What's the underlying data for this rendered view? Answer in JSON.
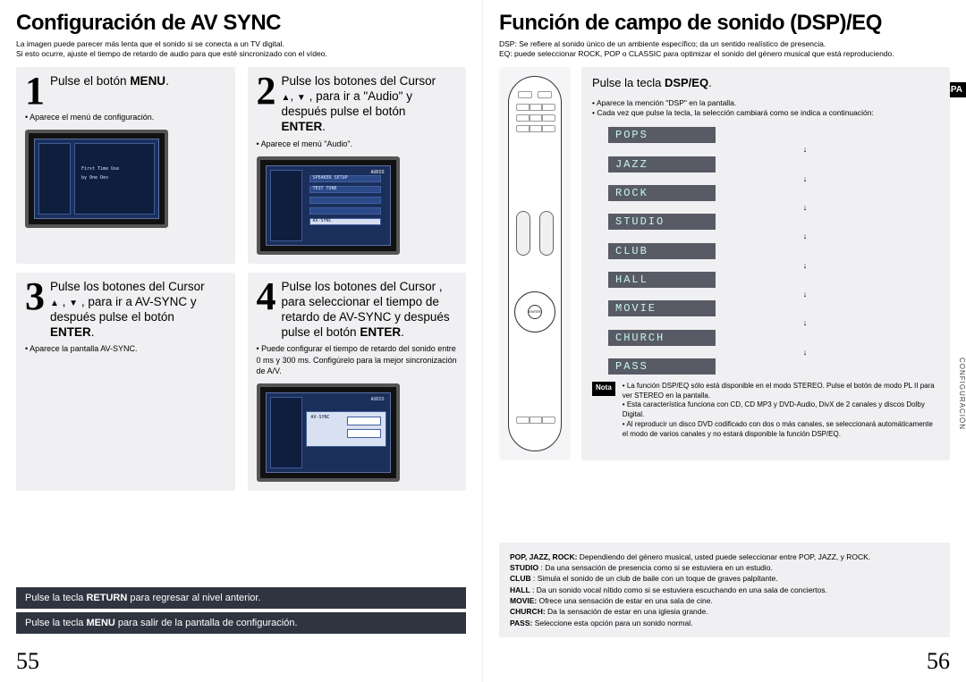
{
  "left": {
    "title": "Configuración de AV SYNC",
    "sub_line1": "La imagen puede parecer más lenta que el sonido si se conecta a un TV digital.",
    "sub_line2": "Si esto ocurre, ajuste el tiempo de retardo de audio para que esté sincronizado con el vídeo.",
    "step1": {
      "num": "1",
      "title_pre": "Pulse el botón ",
      "title_bold": "MENU",
      "title_post": ".",
      "body1": "Aparece el menú de configuración."
    },
    "step2": {
      "num": "2",
      "line1": "Pulse los botones del Cursor",
      "line2_pre": ", ",
      "line2_mid": " , para ir a \"Audio\" y",
      "line3": "después pulse el botón",
      "line4_bold": "ENTER",
      "line4_post": ".",
      "body1": "Aparece el menú \"Audio\"."
    },
    "step3": {
      "num": "3",
      "line1": "Pulse los botones del Cursor",
      "line2": ", , para ir a AV-SYNC y",
      "line3": "después pulse el botón",
      "line4_bold": "ENTER",
      "line4_post": ".",
      "body1": "Aparece la pantalla AV-SYNC."
    },
    "step4": {
      "num": "4",
      "line1": "Pulse los botones del Cursor   ,",
      "line2": "   para seleccionar el tiempo de",
      "line3": "retardo de AV-SYNC y después",
      "line4_pre": "pulse el botón ",
      "line4_bold": "ENTER",
      "line4_post": ".",
      "body1": "Puede configurar el tiempo de retardo del sonido entre 0 ms y 300 ms. Configúrelo para la mejor sincronización de A/V."
    },
    "footer1_pre": "Pulse la tecla ",
    "footer1_bold": "RETURN",
    "footer1_post": " para regresar al nivel anterior.",
    "footer2_pre": "Pulse la tecla ",
    "footer2_bold": "MENU",
    "footer2_post": " para salir de la pantalla de configuración.",
    "page_number": "55"
  },
  "right": {
    "title": "Función de campo de sonido (DSP)/EQ",
    "sub_line1": "DSP: Se refiere al sonido único de un ambiente específico; da un sentido realístico de presencia.",
    "sub_line2": "EQ: puede seleccionar ROCK, POP o CLASSIC para optimizar el sonido del género musical que está reproduciendo.",
    "spa_label": "SPA",
    "side_tab": "CONFIGURACIÓN",
    "step": {
      "title_pre": "Pulse la tecla ",
      "title_bold": "DSP/EQ",
      "title_post": ".",
      "bullet1": "Aparece  la mención \"DSP\" en la pantalla.",
      "bullet2": "Cada vez que pulse la tecla, la selección cambiará como se indica a continuación:"
    },
    "dsp_modes": [
      "POPS",
      "JAZZ",
      "ROCK",
      "STUDIO",
      "CLUB",
      "HALL",
      "MOVIE",
      "CHURCH",
      "PASS"
    ],
    "nota_label": "Nota",
    "nota": {
      "b1": "La función DSP/EQ sólo está disponible en el modo STEREO. Pulse el botón de modo       PL II para ver STEREO en la pantalla.",
      "b2": "Esta característica funciona con CD, CD MP3 y DVD-Audio, DivX de 2 canales y discos Dolby Digital.",
      "b3": "Al reproducir un disco DVD codificado con dos o más canales, se seleccionará automáticamente el modo de varios canales y no estará disponible la función DSP/EQ."
    },
    "modes": {
      "row1_b": "POP, JAZZ, ROCK:",
      "row1_t": " Dependiendo del género musical, usted puede seleccionar entre POP, JAZZ, y ROCK.",
      "row2_b": "STUDIO",
      "row2_t": " : Da una sensación de presencia como si se estuviera en un estudio.",
      "row3_b": "CLUB",
      "row3_t": " : Simula el sonido de un club de baile con un toque de graves palpitante.",
      "row4_b": "HALL",
      "row4_t": " : Da un sonido vocal nítido como si se estuviera escuchando en una sala de conciertos.",
      "row5_b": "MOVIE:",
      "row5_t": " Ofrece una sensación de estar en una sala de cine.",
      "row6_b": "CHURCH:",
      "row6_t": " Da la sensación de estar en una iglesia grande.",
      "row7_b": "PASS:",
      "row7_t": " Seleccione esta opción para un sonido normal."
    },
    "page_number": "56"
  }
}
